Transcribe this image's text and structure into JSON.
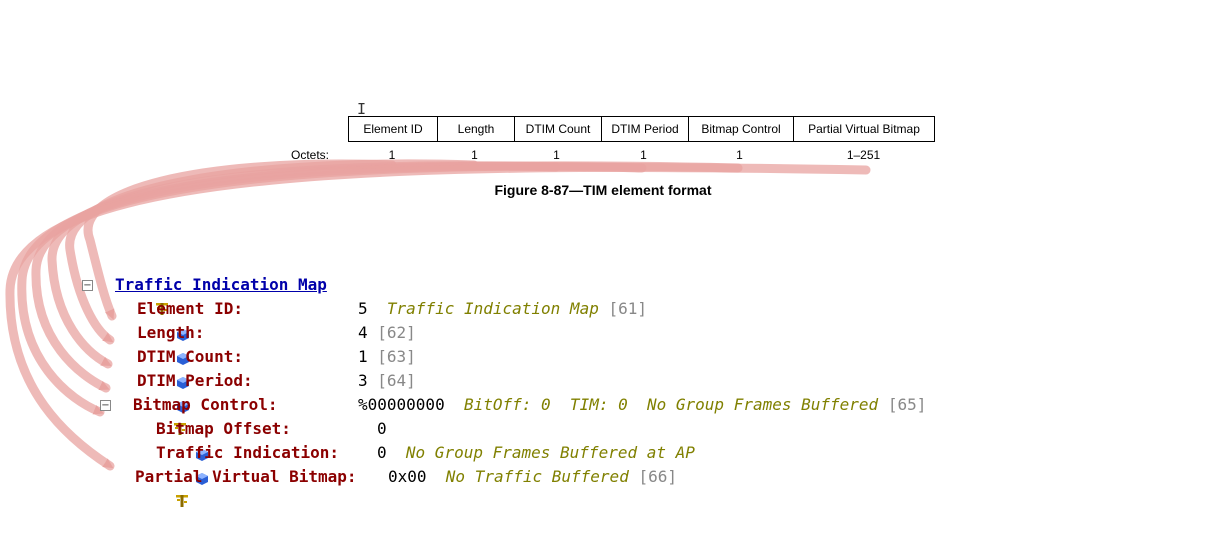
{
  "figure": {
    "columns": [
      "Element ID",
      "Length",
      "DTIM Count",
      "DTIM Period",
      "Bitmap Control",
      "Partial Virtual Bitmap"
    ],
    "octets_label": "Octets:",
    "octets": [
      "1",
      "1",
      "1",
      "1",
      "1",
      "1–251"
    ],
    "caption": "Figure 8-87—TIM element format"
  },
  "tree": {
    "title": "Traffic Indication Map",
    "rows": {
      "element_id": {
        "label": "Element ID:",
        "value": "5",
        "desc": "Traffic Indication Map",
        "ref": "[61]"
      },
      "length": {
        "label": "Length:",
        "value": "4",
        "ref": "[62]"
      },
      "dtim_count": {
        "label": "DTIM Count:",
        "value": "1",
        "ref": "[63]"
      },
      "dtim_period": {
        "label": "DTIM Period:",
        "value": "3",
        "ref": "[64]"
      },
      "bitmap_control": {
        "label": "Bitmap Control:",
        "value": "%00000000",
        "desc": "BitOff: 0  TIM: 0  No Group Frames Buffered",
        "ref": "[65]"
      },
      "bitmap_offset": {
        "label": "Bitmap Offset:",
        "value": "0"
      },
      "traffic_indication": {
        "label": "Traffic Indication:",
        "value": "0",
        "desc": "No Group Frames Buffered at AP"
      },
      "partial_virtual_bitmap": {
        "label": "Partial Virtual Bitmap:",
        "value": "0x00",
        "desc": "No Traffic Buffered",
        "ref": "[66]"
      }
    }
  },
  "colors": {
    "tree_title": "#0000aa",
    "field_label": "#8b0000",
    "description": "#808000",
    "reference": "#888888",
    "arrow": "#e8a3a0"
  },
  "icons": {
    "group": "field-group-icon",
    "leaf": "field-leaf-icon",
    "expander": "collapse-minus-icon"
  }
}
